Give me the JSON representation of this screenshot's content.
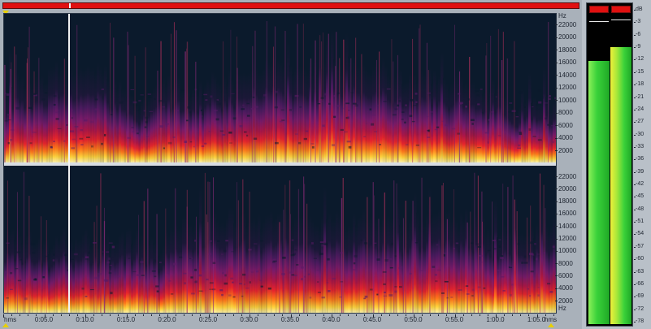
{
  "editor": {
    "overview_position": 0.115,
    "cursor_position": 0.116
  },
  "frequency_axis": {
    "unit": "Hz",
    "ticks": [
      "22000",
      "20000",
      "18000",
      "16000",
      "14000",
      "12000",
      "10000",
      "8000",
      "6000",
      "4000",
      "2000"
    ]
  },
  "time_ruler": {
    "start_label": "hms",
    "end_label": "hms",
    "ticks": [
      "0:05.0",
      "0:10.0",
      "0:15.0",
      "0:20.0",
      "0:25.0",
      "0:30.0",
      "0:35.0",
      "0:40.0",
      "0:45.0",
      "0:50.0",
      "0:55.0",
      "1:00.0",
      "1:05.0"
    ]
  },
  "level_meters": {
    "db_ticks": [
      "dB",
      "-3",
      "-6",
      "-9",
      "-12",
      "-15",
      "-18",
      "-21",
      "-24",
      "-27",
      "-30",
      "-33",
      "-36",
      "-39",
      "-42",
      "-45",
      "-48",
      "-51",
      "-54",
      "-57",
      "-60",
      "-63",
      "-66",
      "-69",
      "-72",
      "-78"
    ],
    "left_level": 0.855,
    "right_level": 0.9,
    "left_peak": 0.985,
    "right_peak": 0.99,
    "clip_indicators": [
      "on",
      "on"
    ]
  },
  "colors": {
    "spectrogram_background": "#0b1a2c",
    "clip": "#e01010",
    "meter_green": "#3ad23a"
  }
}
